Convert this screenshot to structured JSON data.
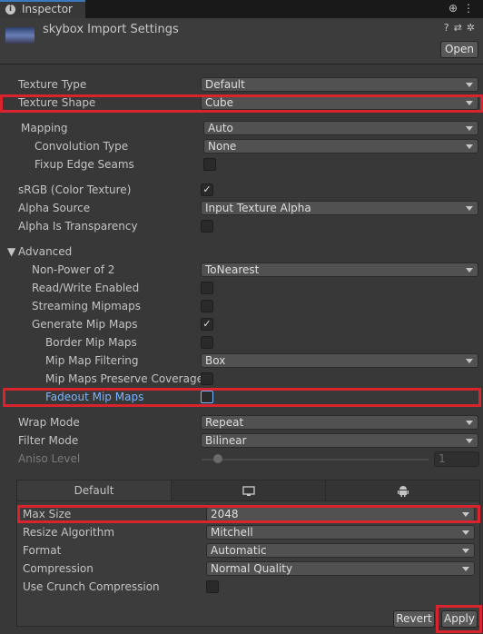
{
  "window": {
    "tab_label": "Inspector"
  },
  "header": {
    "title": "skybox Import Settings",
    "open_button": "Open"
  },
  "fields": {
    "texture_type": {
      "label": "Texture Type",
      "value": "Default"
    },
    "texture_shape": {
      "label": "Texture Shape",
      "value": "Cube"
    },
    "mapping": {
      "label": "Mapping",
      "value": "Auto"
    },
    "convolution_type": {
      "label": "Convolution Type",
      "value": "None"
    },
    "fixup_edge_seams": {
      "label": "Fixup Edge Seams"
    },
    "srgb": {
      "label": "sRGB (Color Texture)"
    },
    "alpha_source": {
      "label": "Alpha Source",
      "value": "Input Texture Alpha"
    },
    "alpha_is_transparency": {
      "label": "Alpha Is Transparency"
    },
    "advanced": {
      "label": "Advanced"
    },
    "non_power_of_2": {
      "label": "Non-Power of 2",
      "value": "ToNearest"
    },
    "read_write": {
      "label": "Read/Write Enabled"
    },
    "streaming_mipmaps": {
      "label": "Streaming Mipmaps"
    },
    "generate_mip_maps": {
      "label": "Generate Mip Maps"
    },
    "border_mip_maps": {
      "label": "Border Mip Maps"
    },
    "mip_map_filtering": {
      "label": "Mip Map Filtering",
      "value": "Box"
    },
    "mip_maps_preserve_coverage": {
      "label": "Mip Maps Preserve Coverage"
    },
    "fadeout_mip_maps": {
      "label": "Fadeout Mip Maps"
    },
    "wrap_mode": {
      "label": "Wrap Mode",
      "value": "Repeat"
    },
    "filter_mode": {
      "label": "Filter Mode",
      "value": "Bilinear"
    },
    "aniso_level": {
      "label": "Aniso Level",
      "value": "1"
    }
  },
  "checks": {
    "srgb": "✓",
    "generate_mip_maps": "✓"
  },
  "platform": {
    "tab_default": "Default",
    "max_size": {
      "label": "Max Size",
      "value": "2048"
    },
    "resize_algorithm": {
      "label": "Resize Algorithm",
      "value": "Mitchell"
    },
    "format": {
      "label": "Format",
      "value": "Automatic"
    },
    "compression": {
      "label": "Compression",
      "value": "Normal Quality"
    },
    "use_crunch": {
      "label": "Use Crunch Compression"
    }
  },
  "footer": {
    "revert": "Revert",
    "apply": "Apply"
  },
  "colors": {
    "highlight": "#d9232d",
    "accent": "#3a79bb",
    "selected_text": "#7ab4ff"
  }
}
